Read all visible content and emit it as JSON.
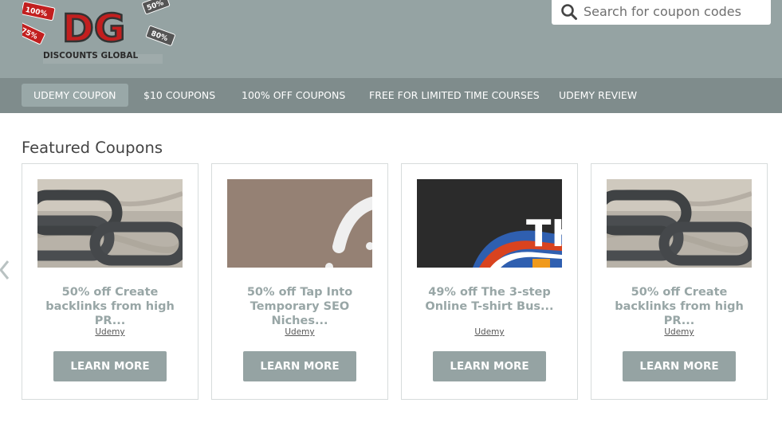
{
  "header": {
    "logo": {
      "text": "DG",
      "subtitle": "DISCOUNTS GLOBAL",
      "tags": [
        "100%",
        "75%",
        "50%",
        "80%"
      ]
    },
    "search": {
      "placeholder": "Search for coupon codes",
      "icon": "search-icon"
    }
  },
  "nav": {
    "items": [
      {
        "label": "UDEMY COUPON",
        "active": true
      },
      {
        "label": "$10 COUPONS",
        "active": false
      },
      {
        "label": "100% OFF COUPONS",
        "active": false
      },
      {
        "label": "FREE FOR LIMITED TIME COURSES",
        "active": false
      },
      {
        "label": "UDEMY REVIEW",
        "active": false
      }
    ]
  },
  "featured": {
    "title": "Featured Coupons",
    "prev_icon": "chevron-left-icon",
    "cards": [
      {
        "title": "50% off Create backlinks from high PR...",
        "vendor": "Udemy",
        "button": "LEARN MORE",
        "image": "chain"
      },
      {
        "title": "50% off Tap Into Temporary SEO Niches...",
        "vendor": "Udemy",
        "button": "LEARN MORE",
        "image": "brown-abstract"
      },
      {
        "title": "49% off The 3-step Online T-shirt Bus...",
        "vendor": "Udemy",
        "button": "LEARN MORE",
        "image": "dark-th",
        "image_text": "TH"
      },
      {
        "title": "50% off Create backlinks from high PR...",
        "vendor": "Udemy",
        "button": "LEARN MORE",
        "image": "chain"
      }
    ]
  }
}
